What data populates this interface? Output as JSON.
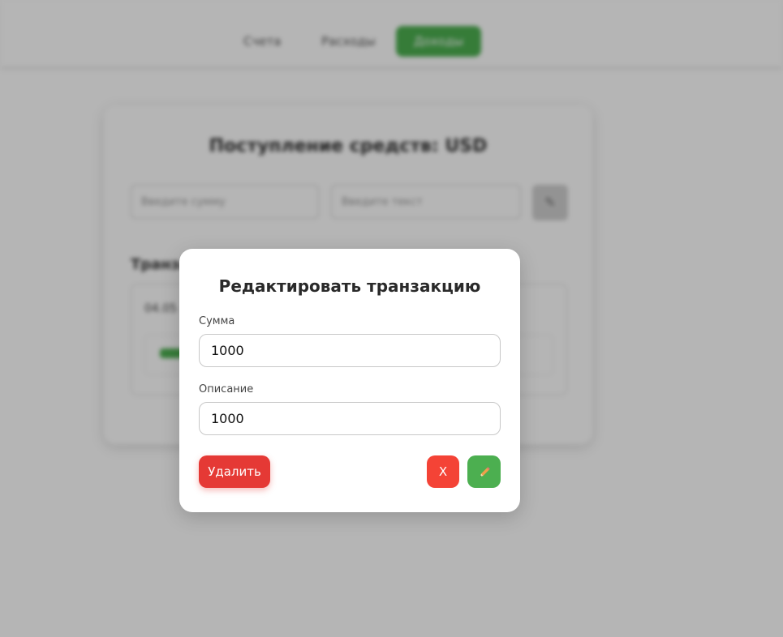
{
  "nav": {
    "items": [
      {
        "label": "Счета"
      },
      {
        "label": "Расходы"
      },
      {
        "label": "Доходы"
      }
    ]
  },
  "background_card": {
    "title": "Поступление средств: USD",
    "amount_placeholder": "Введите сумму",
    "text_placeholder": "Введите текст",
    "transactions_heading": "Транзакции",
    "transaction_date": "04.05"
  },
  "modal": {
    "title": "Редактировать транзакцию",
    "amount_label": "Сумма",
    "amount_value": "1000",
    "description_label": "Описание",
    "description_value": "1000",
    "delete_label": "Удалить",
    "cancel_label": "X",
    "save_icon": "pencil-icon"
  },
  "colors": {
    "accent_green": "#4caf50",
    "danger_red": "#e53935",
    "cancel_red": "#f44336"
  }
}
